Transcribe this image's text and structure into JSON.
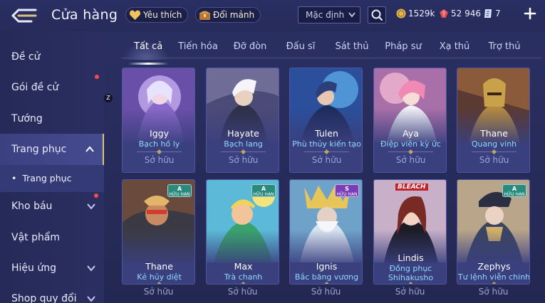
{
  "header": {
    "title": "Cửa hàng",
    "favorites_label": "Yêu thích",
    "exchange_label": "Đổi mảnh",
    "sort": {
      "selected": "Mặc định"
    },
    "currencies": [
      {
        "name": "gold-coin-icon",
        "value": "1529k"
      },
      {
        "name": "ruby-icon",
        "value": "52 946"
      },
      {
        "name": "voucher-icon",
        "value": "7"
      }
    ]
  },
  "sidebar": {
    "items": [
      {
        "label": "Đề cử"
      },
      {
        "label": "Gói đề cử"
      },
      {
        "label": "Tướng"
      },
      {
        "label": "Trang phục"
      },
      {
        "label": "Trang phục"
      },
      {
        "label": "Kho báu"
      },
      {
        "label": "Vật phẩm"
      },
      {
        "label": "Hiệu ứng"
      },
      {
        "label": "Shop quy đổi"
      }
    ],
    "notification_badge": "Z"
  },
  "tabs": [
    "Tất cả",
    "Tiến hóa",
    "Đỡ đòn",
    "Đấu sĩ",
    "Sát thủ",
    "Pháp sư",
    "Xạ thủ",
    "Trợ thủ"
  ],
  "cards": [
    {
      "hero": "Iggy",
      "skin": "Bạch hồ ly",
      "status": "Sở hữu"
    },
    {
      "hero": "Hayate",
      "skin": "Bạch lang",
      "status": "Sở hữu"
    },
    {
      "hero": "Tulen",
      "skin": "Phù thủy kiến tạo",
      "status": "Sở hữu"
    },
    {
      "hero": "Aya",
      "skin": "Điệp viên kỳ ức",
      "status": "Sở hữu"
    },
    {
      "hero": "Thane",
      "skin": "Quang vinh",
      "status": "Sở hữu"
    },
    {
      "hero": "Thane",
      "skin": "Kẻ hủy diệt",
      "status": "Sở hữu",
      "tier": "A",
      "tier_sub": "HỮU HẠN"
    },
    {
      "hero": "Max",
      "skin": "Trà chanh",
      "status": "Sở hữu",
      "tier": "A",
      "tier_sub": "HỮU HẠN"
    },
    {
      "hero": "Ignis",
      "skin": "Bắc băng vương",
      "status": "Sở hữu",
      "tier": "S",
      "tier_sub": "HỮU HẠN"
    },
    {
      "hero": "Lindis",
      "skin": "Đồng phục Shihakusho",
      "status": "Sở hữu",
      "collab_logo": "BLEACH"
    },
    {
      "hero": "Zephys",
      "skin": "Tư lệnh viễn chinh",
      "status": "Sở hữu",
      "tier": "A",
      "tier_sub": "HỮU HẠN"
    }
  ],
  "colors": {
    "background": "#2b3064",
    "accent_gold": "#d9c27a",
    "skin_name": "#8fd9ff",
    "notification": "#ff4a4a"
  }
}
